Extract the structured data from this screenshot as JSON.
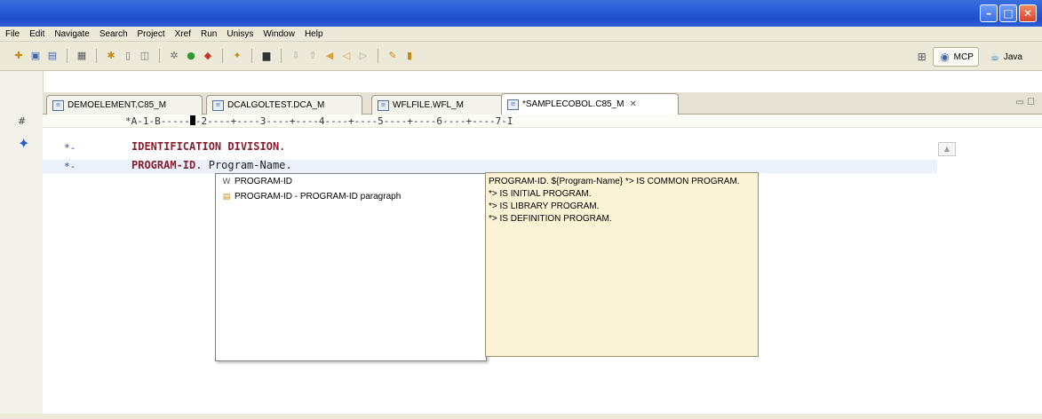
{
  "window": {
    "minimize_glyph": "–",
    "maximize_glyph": "□",
    "close_glyph": "✕"
  },
  "menu": [
    "File",
    "Edit",
    "Navigate",
    "Search",
    "Project",
    "Xref",
    "Run",
    "Unisys",
    "Window",
    "Help"
  ],
  "perspectives": {
    "mcp_label": "MCP",
    "java_label": "Java"
  },
  "tabs": [
    {
      "label": "DEMOELEMENT.C85_M",
      "close": ""
    },
    {
      "label": "DCALGOLTEST.DCA_M",
      "close": ""
    },
    {
      "label": "WFLFILE.WFL_M",
      "close": ""
    },
    {
      "label": "*SAMPLECOBOL.C85_M",
      "close": "✕"
    }
  ],
  "view_controls": "▭ ☐",
  "editor": {
    "ruler_left": "*A-1-B-----",
    "ruler_right": "-2----+----3----+----4----+----5----+----6----+----7-I",
    "markers": [
      "*-",
      "*-"
    ],
    "lines": [
      {
        "keyword": "IDENTIFICATION DIVISION",
        "rest": "."
      },
      {
        "keyword": "PROGRAM-ID",
        "rest": ". Program-Name."
      }
    ]
  },
  "content_assist": {
    "items": [
      "PROGRAM-ID",
      "PROGRAM-ID - PROGRAM-ID paragraph"
    ],
    "info_lines": [
      "PROGRAM-ID. ${Program-Name} *> IS COMMON PROGRAM.",
      "*> IS INITIAL PROGRAM.",
      "*> IS LIBRARY PROGRAM.",
      "*> IS DEFINITION PROGRAM."
    ]
  }
}
